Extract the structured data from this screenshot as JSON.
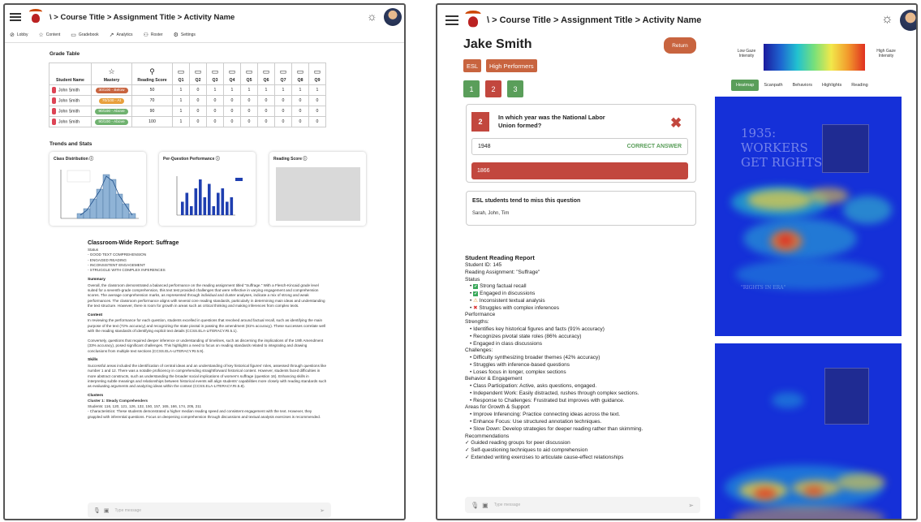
{
  "left": {
    "breadcrumb": "\\ > Course Title > Assignment Title > Activity Name",
    "nav": [
      {
        "icon": "lobby-icon",
        "label": "Lobby"
      },
      {
        "icon": "star-icon",
        "label": "Content"
      },
      {
        "icon": "book-icon",
        "label": "Gradebook"
      },
      {
        "icon": "analytics-icon",
        "label": "Analytics"
      },
      {
        "icon": "roster-icon",
        "label": "Roster"
      },
      {
        "icon": "gear-icon",
        "label": "Settings"
      }
    ],
    "grade_table": {
      "title": "Grade Table",
      "headers": [
        "Student Name",
        "Mastery",
        "Reading Score",
        "Q1",
        "Q2",
        "Q3",
        "Q4",
        "Q5",
        "Q6",
        "Q7",
        "Q8",
        "Q9"
      ],
      "rows": [
        {
          "name": "John Smith",
          "mastery": "30/100 - Below",
          "mastery_color": "#c8643f",
          "score": "50",
          "q": [
            "1",
            "0",
            "1",
            "1",
            "1",
            "1",
            "1",
            "1",
            "1"
          ]
        },
        {
          "name": "John Smith",
          "mastery": "70/100 - At",
          "mastery_color": "#e8a03c",
          "score": "70",
          "q": [
            "1",
            "0",
            "0",
            "0",
            "0",
            "0",
            "0",
            "0",
            "0"
          ]
        },
        {
          "name": "John Smith",
          "mastery": "90/100 - Above",
          "mastery_color": "#6fb26f",
          "score": "90",
          "q": [
            "1",
            "0",
            "0",
            "0",
            "0",
            "0",
            "0",
            "0",
            "0"
          ]
        },
        {
          "name": "John Smith",
          "mastery": "90/100 - Above",
          "mastery_color": "#6fb26f",
          "score": "100",
          "q": [
            "1",
            "0",
            "0",
            "0",
            "0",
            "0",
            "0",
            "0",
            "0"
          ]
        }
      ]
    },
    "trends": {
      "title": "Trends and Stats",
      "cards": [
        "Class Distribution",
        "Per-Question Performance",
        "Reading Score"
      ]
    },
    "chart_data": [
      {
        "type": "bar",
        "title": "Class Distribution",
        "values": [
          1,
          2,
          4,
          6,
          9,
          8,
          5,
          3,
          1
        ]
      },
      {
        "type": "bar",
        "title": "Per-Question Performance",
        "values": [
          3,
          5,
          2,
          6,
          8,
          4,
          7,
          2,
          5,
          6,
          3,
          4
        ]
      }
    ],
    "report": {
      "title": "Classroom-Wide Report: Suffrage",
      "status_label": "Status",
      "status": [
        "- GOOD TEXT COMPREHENSION",
        "- ENGAGED READING",
        "- INCONSISTENT ENGAGEMENT",
        "- STRUGGLE WITH COMPLEX INFERENCES"
      ],
      "summary_h": "Summary",
      "summary": "Overall, the classroom demonstrated a balanced performance on the reading assignment titled \"Suffrage.\" With a Flesch-Kincaid grade level suited for a seventh-grade comprehension, this text test provided challenges that were reflective in varying engagement and comprehension scores. The average comprehension marks, as represented through individual and cluster analyses, indicate a mix of strong and weak performances. The classroom performance aligns with several core reading standards, particularly in determining main ideas and understanding the text structure. However, there is room for growth in areas such as critical thinking and making inferences from complex texts.",
      "content_h": "Content",
      "content1": "In reviewing the performance for each question, students excelled in questions that revolved around factual recall, such as identifying the main purpose of the text (72% accuracy) and recognizing the state pivotal in passing the amendment (81% accuracy). These successes correlate well with the reading standards of identifying explicit text details (CCSS.ELA-LITERACY.RI.5.1).",
      "content2": "Conversely, questions that required deeper inference or understanding of timelines, such as discerning the implications of the 19th Amendment (33% accuracy), posed significant challenges. This highlights a need to focus on reading standards related to integrating and drawing conclusions from multiple text sections (CCSS.ELA-LITERACY.RI.5.9).",
      "skills_h": "Skills",
      "skills": "Successful areas included the identification of central ideas and an understanding of key historical figures' roles, assessed through questions like number 1 and 12. There was a notable proficiency in comprehending straightforward historical content. However, students faced difficulties in more abstract constructs, such as understanding the broader social implications of women's suffrage (question 16). Enhancing skills in interpreting subtle meanings and relationships between historical events will align students' capabilities more closely with reading standards such as evaluating arguments and analyzing ideas within the context (CCSS.ELA-LITERACY.RI.5.8).",
      "clusters_h": "Clusters",
      "cluster1_h": "Cluster 1: Steady Comprehenders",
      "cluster1_students": "Students: 116, 120, 121, 126, 132, 150, 157, 165, 166, 174, 205, 211",
      "cluster1_char": "- Characteristics: These students demonstrated a higher median reading speed and consistent engagement with the text. However, they grappled with inferential questions. Focus on deepening comprehension through discussions and textual analysis exercises is recommended."
    },
    "message_placeholder": "Type message"
  },
  "right": {
    "breadcrumb": "\\ > Course Title > Assignment Title > Activity Name",
    "student_name": "Jake Smith",
    "return_label": "Return",
    "tags": [
      "ESL",
      "High Performers"
    ],
    "question_buttons": [
      {
        "label": "1",
        "color": "#5a9e5a"
      },
      {
        "label": "2",
        "color": "#c2473e"
      },
      {
        "label": "3",
        "color": "#5a9e5a"
      }
    ],
    "question": {
      "number": "2",
      "text": "In which year was the National Labor Union formed?",
      "correct_answer": "1948",
      "correct_label": "CORRECT ANSWER",
      "student_answer": "1866"
    },
    "insight": {
      "title": "ESL students tend to miss this question",
      "names": "Sarah, John, Tim"
    },
    "report": {
      "title": "Student Reading Report",
      "student_id": "Student ID: 145",
      "assignment": "Reading Assignment: \"Suffrage\"",
      "status_label": "Status",
      "status": [
        {
          "icon": "check-icon",
          "text": "Strong factual recall"
        },
        {
          "icon": "check-icon",
          "text": "Engaged in discussions"
        },
        {
          "icon": "warning-icon",
          "text": "Inconsistent textual analysis"
        },
        {
          "icon": "cross-icon",
          "text": "Struggles with complex inferences"
        }
      ],
      "performance_label": "Performance",
      "strengths_label": "Strengths:",
      "strengths": [
        "Identifies key historical figures and facts (91% accuracy)",
        "Recognizes pivotal state roles (86% accuracy)",
        "Engaged in class discussions"
      ],
      "challenges_label": "Challenges:",
      "challenges": [
        "Difficulty synthesizing broader themes (42% accuracy)",
        "Struggles with inference-based questions",
        "Loses focus in longer, complex sections"
      ],
      "behavior_label": "Behavior & Engagement",
      "behavior": [
        "Class Participation: Active, asks questions, engaged.",
        "Independent Work: Easily distracted, rushes through complex sections.",
        "Response to Challenges: Frustrated but improves with guidance."
      ],
      "growth_label": "Areas for Growth & Support",
      "growth": [
        "Improve Inferencing: Practice connecting ideas across the text.",
        "Enhance Focus: Use structured annotation techniques.",
        "Slow Down: Develop strategies for deeper reading rather than skimming."
      ],
      "rec_label": "Recommendations",
      "recommendations": [
        "Guided reading groups for peer discussion",
        "Self-questioning techniques to aid comprehension",
        "Extended writing exercises to articulate cause-effect relationships"
      ]
    },
    "legend": {
      "low": "Low Gaze Intensity",
      "high": "High Gaze Intensity"
    },
    "tabs": [
      "Heatmap",
      "Scanpath",
      "Behaviors",
      "Highlights",
      "Reading"
    ],
    "heatmap_text": {
      "year": "1935:",
      "h1": "WORKERS",
      "h2": "GET RIGHTS",
      "sub": "\"RIGHTS IN ERA\""
    },
    "message_placeholder": "Type message"
  }
}
